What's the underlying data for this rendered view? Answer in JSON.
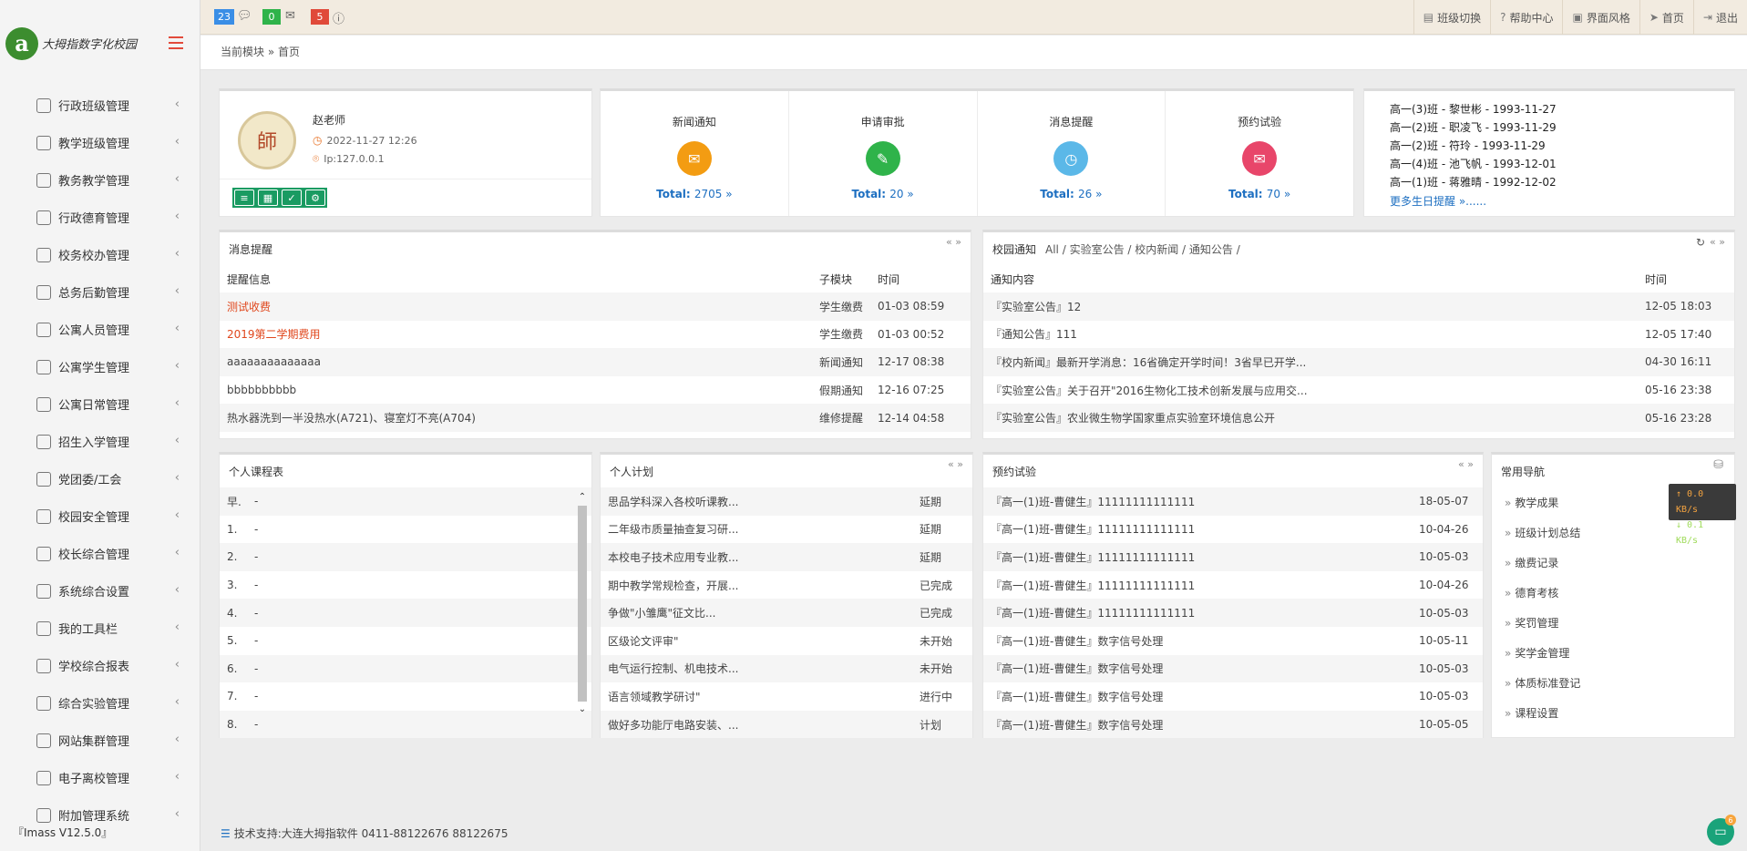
{
  "brand": {
    "logo_letter": "a",
    "name": "大拇指数字化校园"
  },
  "version": "『Imass V12.5.0』",
  "sidebar": {
    "items": [
      {
        "label": "行政班级管理",
        "icon": "class-icon"
      },
      {
        "label": "教学班级管理",
        "icon": "calendar-icon"
      },
      {
        "label": "教务教学管理",
        "icon": "teacher-icon"
      },
      {
        "label": "行政德育管理",
        "icon": "user-icon"
      },
      {
        "label": "校务校办管理",
        "icon": "edit-doc-icon"
      },
      {
        "label": "总务后勤管理",
        "icon": "moneybag-icon"
      },
      {
        "label": "公寓人员管理",
        "icon": "list-icon"
      },
      {
        "label": "公寓学生管理",
        "icon": "id-card-icon"
      },
      {
        "label": "公寓日常管理",
        "icon": "schedule-icon"
      },
      {
        "label": "招生入学管理",
        "icon": "group-icon"
      },
      {
        "label": "党团委/工会",
        "icon": "badge-icon"
      },
      {
        "label": "校园安全管理",
        "icon": "clock-icon"
      },
      {
        "label": "校长综合管理",
        "icon": "users-icon"
      },
      {
        "label": "系统综合设置",
        "icon": "database-icon"
      },
      {
        "label": "我的工具栏",
        "icon": "user-tool-icon"
      },
      {
        "label": "学校综合报表",
        "icon": "report-icon"
      },
      {
        "label": "综合实验管理",
        "icon": "timer-icon"
      },
      {
        "label": "网站集群管理",
        "icon": "globe-icon"
      },
      {
        "label": "电子离校管理",
        "icon": "user-out-icon"
      },
      {
        "label": "附加管理系统",
        "icon": "stack-icon"
      }
    ]
  },
  "topbar": {
    "badges": [
      {
        "count": "23",
        "color": "#3a8ee6",
        "icon": "chat-icon"
      },
      {
        "count": "0",
        "color": "#2fb34a",
        "icon": "mail-icon"
      },
      {
        "count": "5",
        "color": "#e04a3a",
        "icon": "info-icon"
      }
    ],
    "links": [
      {
        "label": "班级切换",
        "icon": "switch-icon"
      },
      {
        "label": "帮助中心",
        "icon": "help-icon"
      },
      {
        "label": "界面风格",
        "icon": "palette-icon"
      },
      {
        "label": "首页",
        "icon": "send-icon"
      },
      {
        "label": "退出",
        "icon": "logout-icon"
      }
    ]
  },
  "breadcrumb": {
    "prefix": "当前模块",
    "sep": "»",
    "current": "首页"
  },
  "profile": {
    "avatar_text": "師",
    "name": "赵老师",
    "time": "2022-11-27 12:26",
    "ip": "Ip:127.0.0.1"
  },
  "stats": [
    {
      "title": "新闻通知",
      "total_label": "Total:",
      "total": "2705 »",
      "color": "#f39c12",
      "icon": "chat-bubble-icon"
    },
    {
      "title": "申请审批",
      "total_label": "Total:",
      "total": "20 »",
      "color": "#2fb34a",
      "icon": "approve-icon"
    },
    {
      "title": "消息提醒",
      "total_label": "Total:",
      "total": "26 »",
      "color": "#5bb8e8",
      "icon": "stopwatch-icon"
    },
    {
      "title": "预约试验",
      "total_label": "Total:",
      "total": "70 »",
      "color": "#e8466a",
      "icon": "mail-icon"
    }
  ],
  "birthdays": {
    "rows": [
      "高一(3)班 - 黎世彬 - 1993-11-27",
      "高一(2)班 - 职凌飞 - 1993-11-29",
      "高一(2)班 - 符玲 - 1993-11-29",
      "高一(4)班 - 池飞帆 - 1993-12-01",
      "高一(1)班 - 蒋雅晴 - 1992-12-02"
    ],
    "more": "更多生日提醒 »......"
  },
  "messages": {
    "title": "消息提醒",
    "tools": "« »",
    "headers": [
      "提醒信息",
      "子模块",
      "时间"
    ],
    "rows": [
      {
        "info": "测试收费",
        "module": "学生缴费",
        "time": "01-03 08:59",
        "highlight": true
      },
      {
        "info": "2019第二学期费用",
        "module": "学生缴费",
        "time": "01-03 00:52",
        "highlight": true
      },
      {
        "info": "aaaaaaaaaaaaaa",
        "module": "新闻通知",
        "time": "12-17 08:38",
        "highlight": false
      },
      {
        "info": "bbbbbbbbbb",
        "module": "假期通知",
        "time": "12-16 07:25",
        "highlight": false
      },
      {
        "info": "热水器洗到一半没热水(A721)、寝室灯不亮(A704)",
        "module": "维修提醒",
        "time": "12-14 04:58",
        "highlight": false
      }
    ]
  },
  "notices": {
    "title": "校园通知",
    "categories": "All / 实验室公告 / 校内新闻 / 通知公告 /",
    "tools": "« »",
    "headers": [
      "通知内容",
      "时间"
    ],
    "rows": [
      {
        "content": "『实验室公告』12",
        "time": "12-05 18:03"
      },
      {
        "content": "『通知公告』111",
        "time": "12-05 17:40"
      },
      {
        "content": "『校内新闻』最新开学消息：16省确定开学时间！3省早已开学...",
        "time": "04-30 16:11"
      },
      {
        "content": "『实验室公告』关于召开\"2016生物化工技术创新发展与应用交...",
        "time": "05-16 23:38"
      },
      {
        "content": "『实验室公告』农业微生物学国家重点实验室环境信息公开",
        "time": "05-16 23:28"
      }
    ]
  },
  "schedule": {
    "title": "个人课程表",
    "rows": [
      {
        "period": "早.",
        "course": "-"
      },
      {
        "period": "1.",
        "course": "-"
      },
      {
        "period": "2.",
        "course": "-"
      },
      {
        "period": "3.",
        "course": "-"
      },
      {
        "period": "4.",
        "course": "-"
      },
      {
        "period": "5.",
        "course": "-"
      },
      {
        "period": "6.",
        "course": "-"
      },
      {
        "period": "7.",
        "course": "-"
      },
      {
        "period": "8.",
        "course": "-"
      }
    ]
  },
  "plan": {
    "title": "个人计划",
    "tools": "« »",
    "rows": [
      {
        "name": "思品学科深入各校听课教...",
        "status": "延期"
      },
      {
        "name": "二年级市质量抽查复习研...",
        "status": "延期"
      },
      {
        "name": "本校电子技术应用专业教...",
        "status": "延期"
      },
      {
        "name": "期中教学常规检查，开展...",
        "status": "已完成"
      },
      {
        "name": "争做\"小雏鹰\"征文比...",
        "status": "已完成"
      },
      {
        "name": "区级论文评审\"",
        "status": "未开始"
      },
      {
        "name": "电气运行控制、机电技术...",
        "status": "未开始"
      },
      {
        "name": "语言领域教学研讨\"",
        "status": "进行中"
      },
      {
        "name": "做好多功能厅电路安装、...",
        "status": "计划"
      }
    ]
  },
  "reserve": {
    "title": "预约试验",
    "tools": "« »",
    "rows": [
      {
        "name": "『高一(1)班-曹健生』11111111111111",
        "date": "18-05-07"
      },
      {
        "name": "『高一(1)班-曹健生』11111111111111",
        "date": "10-04-26"
      },
      {
        "name": "『高一(1)班-曹健生』11111111111111",
        "date": "10-05-03"
      },
      {
        "name": "『高一(1)班-曹健生』11111111111111",
        "date": "10-04-26"
      },
      {
        "name": "『高一(1)班-曹健生』11111111111111",
        "date": "10-05-03"
      },
      {
        "name": "『高一(1)班-曹健生』数字信号处理",
        "date": "10-05-11"
      },
      {
        "name": "『高一(1)班-曹健生』数字信号处理",
        "date": "10-05-03"
      },
      {
        "name": "『高一(1)班-曹健生』数字信号处理",
        "date": "10-05-03"
      },
      {
        "name": "『高一(1)班-曹健生』数字信号处理",
        "date": "10-05-05"
      }
    ]
  },
  "quicknav": {
    "title": "常用导航",
    "items": [
      "教学成果",
      "班级计划总结",
      "缴费记录",
      "德育考核",
      "奖罚管理",
      "奖学金管理",
      "体质标准登记",
      "课程设置"
    ]
  },
  "netspeed": {
    "up": "↑ 0.0 KB/s",
    "down": "↓ 0.1 KB/s"
  },
  "footer": {
    "text": "技术支持:大连大拇指软件 0411-88122676 88122675"
  },
  "chat_widget": {
    "badge": "6"
  }
}
